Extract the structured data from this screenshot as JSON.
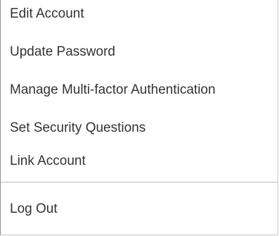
{
  "menu": {
    "items": [
      {
        "label": "Edit Account"
      },
      {
        "label": "Update Password"
      },
      {
        "label": "Manage Multi-factor Authentication"
      },
      {
        "label": "Set Security Questions"
      },
      {
        "label": "Link Account"
      }
    ],
    "logout_label": "Log Out"
  },
  "colors": {
    "text": "#333333",
    "background": "#ffffff",
    "divider": "#b9b9b9",
    "border": "#c8c8c8"
  }
}
